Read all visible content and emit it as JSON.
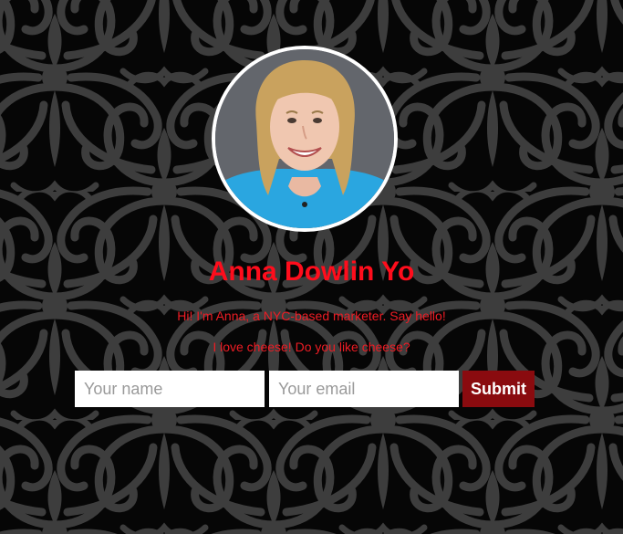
{
  "colors": {
    "background": "#060606",
    "pattern": "#3b3b3b",
    "name_text": "#ff0d1c",
    "bio_text": "#ee1c24",
    "submit_bg": "#8a0b0f",
    "submit_text": "#ffffff",
    "avatar_border": "#ffffff"
  },
  "profile": {
    "photo_icon": "profile-photo",
    "name": "Anna Dowlin Yo",
    "bio_line_1": "Hi! I'm Anna, a NYC-based marketer. Say hello!",
    "bio_line_2": "I love cheese! Do you like cheese?"
  },
  "form": {
    "name_placeholder": "Your name",
    "email_placeholder": "Your email",
    "submit_label": "Submit"
  }
}
